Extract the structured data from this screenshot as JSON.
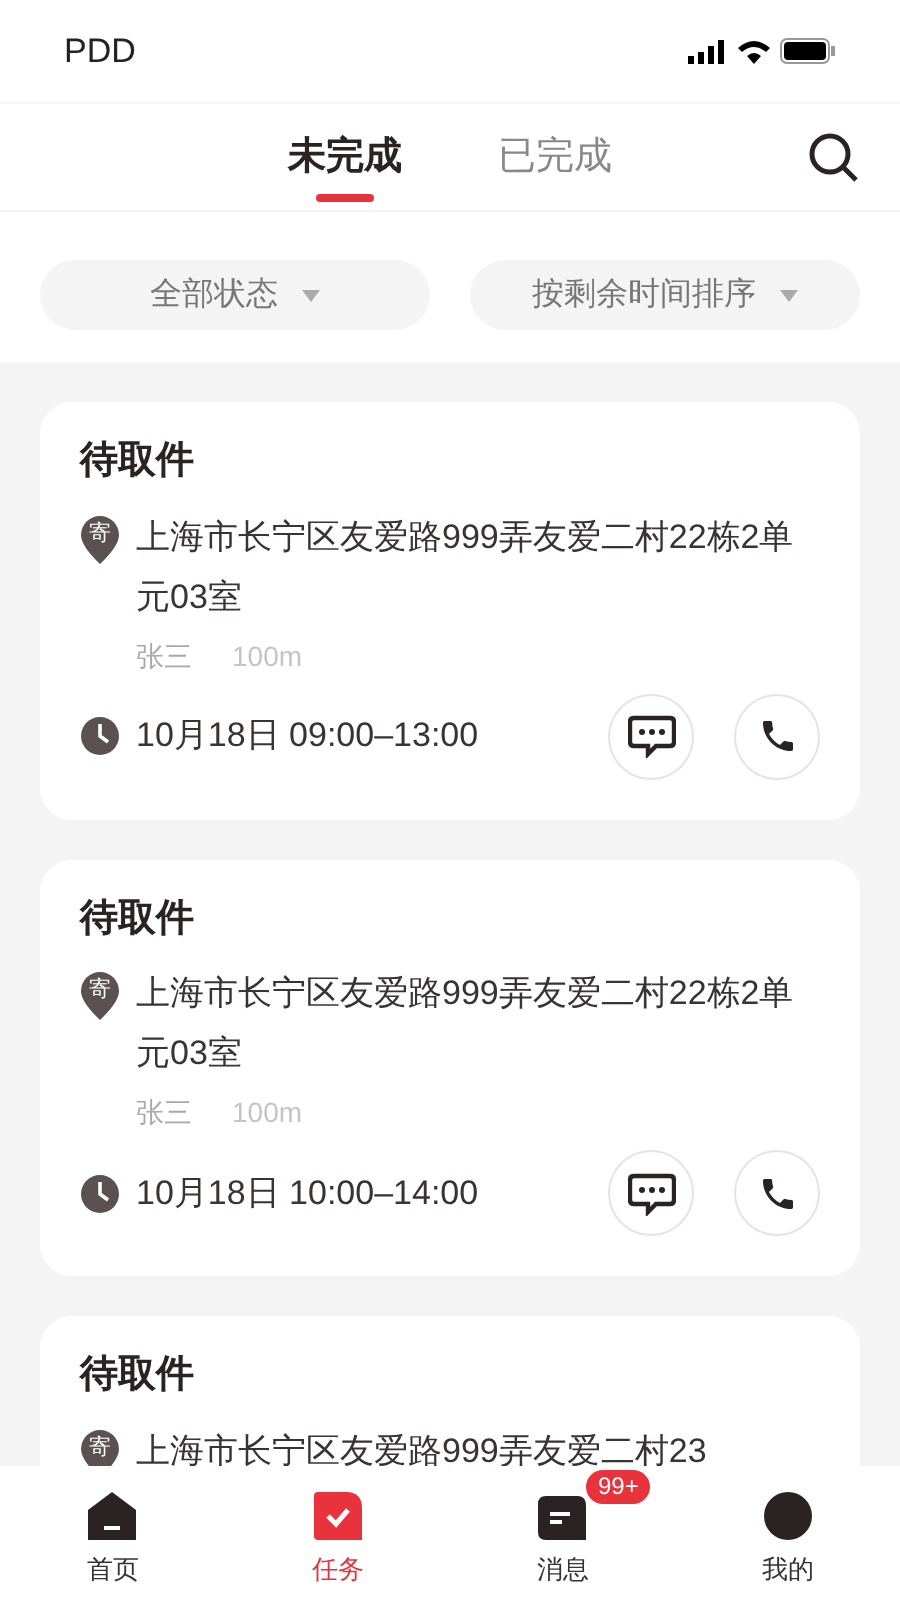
{
  "status_bar": {
    "carrier": "PDD"
  },
  "tabs": [
    {
      "label": "未完成",
      "selected": true
    },
    {
      "label": "已完成",
      "selected": false
    }
  ],
  "filters": [
    {
      "label": "全部状态"
    },
    {
      "label": "按剩余时间排序"
    }
  ],
  "tasks": [
    {
      "title": "待取件",
      "badge": "寄",
      "address": "上海市长宁区友爱路999弄友爱二村22栋2单元03室",
      "name": "张三",
      "distance": "100m",
      "time": "10月18日 09:00–13:00"
    },
    {
      "title": "待取件",
      "badge": "寄",
      "address": "上海市长宁区友爱路999弄友爱二村22栋2单元03室",
      "name": "张三",
      "distance": "100m",
      "time": "10月18日 10:00–14:00"
    },
    {
      "title": "待取件",
      "badge": "寄",
      "address": "上海市长宁区友爱路999弄友爱二村23"
    }
  ],
  "nav": [
    {
      "kind": "home",
      "label": "首页",
      "selected": false
    },
    {
      "kind": "task",
      "label": "任务",
      "selected": true
    },
    {
      "kind": "message",
      "label": "消息",
      "selected": false,
      "badge": "99+"
    },
    {
      "kind": "me",
      "label": "我的",
      "selected": false
    }
  ]
}
